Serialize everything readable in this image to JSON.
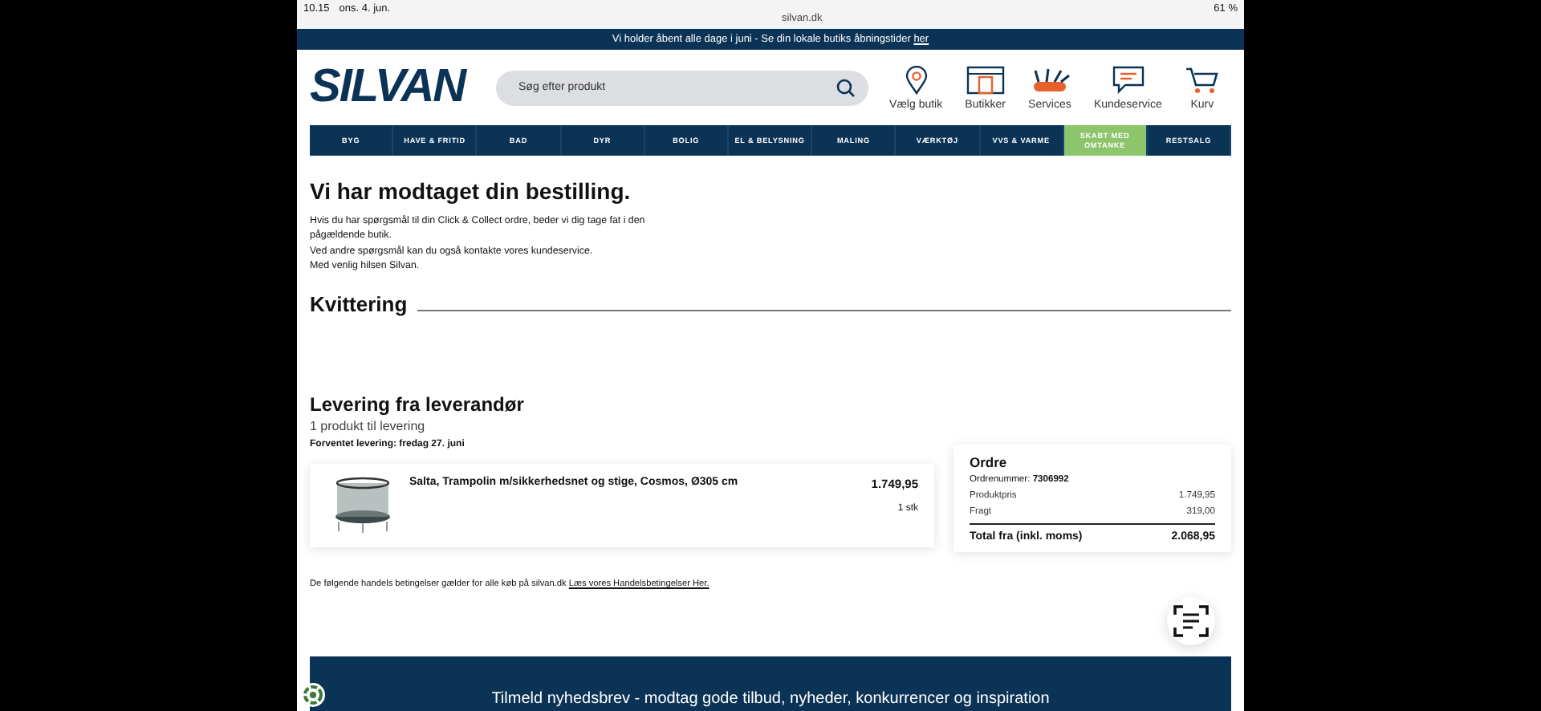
{
  "status_bar": {
    "time": "10.15",
    "date": "ons. 4. jun.",
    "url": "silvan.dk",
    "battery": "61 %"
  },
  "banner": {
    "text": "Vi holder åbent alle dage i juni - Se din lokale butiks åbningstider ",
    "link": "her"
  },
  "header": {
    "logo": "SILVAN",
    "search": {
      "placeholder": "Søg efter produkt"
    },
    "actions": [
      {
        "kind": "pin",
        "label": "Vælg butik"
      },
      {
        "kind": "store",
        "label": "Butikker"
      },
      {
        "kind": "tools",
        "label": "Services"
      },
      {
        "kind": "chat",
        "label": "Kundeservice"
      },
      {
        "kind": "cart",
        "label": "Kurv"
      }
    ]
  },
  "nav": [
    {
      "label": "BYG",
      "highlighted": false
    },
    {
      "label": "HAVE & FRITID",
      "highlighted": false
    },
    {
      "label": "BAD",
      "highlighted": false
    },
    {
      "label": "DYR",
      "highlighted": false
    },
    {
      "label": "BOLIG",
      "highlighted": false
    },
    {
      "label": "EL & BELYSNING",
      "highlighted": false
    },
    {
      "label": "MALING",
      "highlighted": false
    },
    {
      "label": "VÆRKTØJ",
      "highlighted": false
    },
    {
      "label": "VVS & VARME",
      "highlighted": false
    },
    {
      "label": "SKABT MED OMTANKE",
      "highlighted": true
    },
    {
      "label": "RESTSALG",
      "highlighted": false
    }
  ],
  "confirmation": {
    "title": "Vi har modtaget din bestilling.",
    "lines": [
      "Hvis du har spørgsmål til din Click & Collect ordre, beder vi dig tage fat i den pågældende butik.",
      "Ved andre spørgsmål kan du også kontakte vores kundeservice.",
      "Med venlig hilsen Silvan."
    ]
  },
  "receipt": {
    "title": "Kvittering"
  },
  "delivery": {
    "title": "Levering fra leverandør",
    "count": "1 produkt til levering",
    "expected": "Forventet levering: fredag 27. juni",
    "product": {
      "name": "Salta, Trampolin m/sikkerhedsnet og stige, Cosmos, Ø305 cm",
      "price": "1.749,95",
      "quantity": "1 stk"
    }
  },
  "order": {
    "title": "Ordre",
    "number_label": "Ordrenummer: ",
    "number": "7306992",
    "rows": [
      {
        "label": "Produktpris",
        "value": "1.749,95"
      },
      {
        "label": "Fragt",
        "value": "319,00"
      }
    ],
    "total_label": "Total fra (inkl. moms)",
    "total": "2.068,95"
  },
  "terms": {
    "text": "De følgende handels betingelser gælder for alle køb på silvan.dk ",
    "link": "Læs vores Handelsbetingelser Her."
  },
  "newsletter": {
    "text": "Tilmeld nyhedsbrev - modtag gode tilbud, nyheder, konkurrencer og inspiration"
  }
}
